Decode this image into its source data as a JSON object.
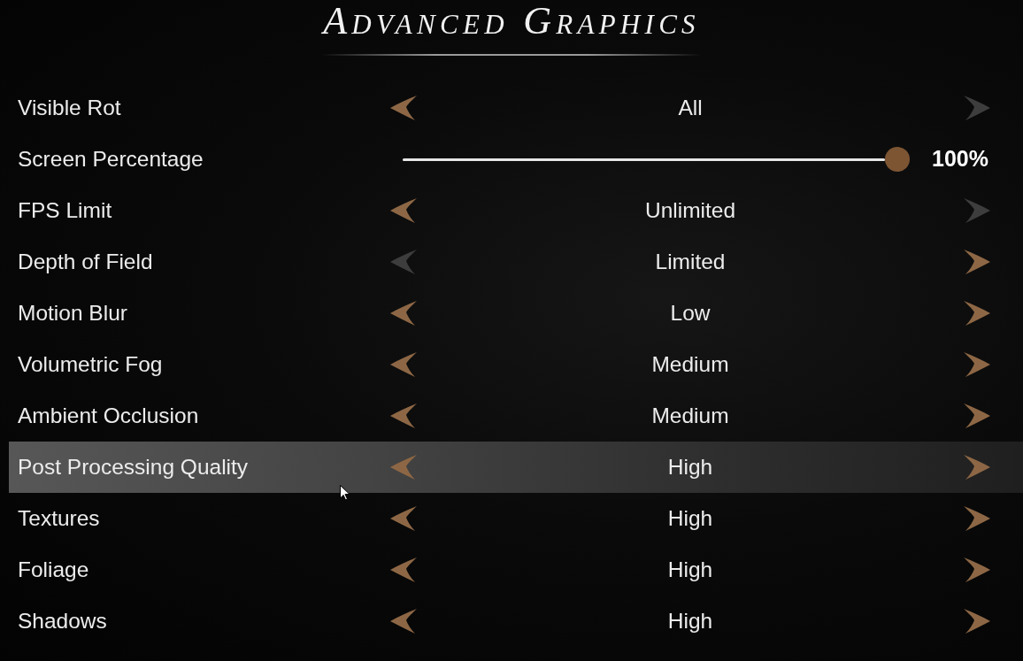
{
  "title": "Advanced Graphics",
  "settings": [
    {
      "kind": "selector",
      "label": "Visible Rot",
      "value": "All",
      "left_arrow_enabled": true,
      "right_arrow_enabled": false,
      "selected": false
    },
    {
      "kind": "slider",
      "label": "Screen Percentage",
      "level": 1,
      "reading": "100%",
      "selected": false
    },
    {
      "kind": "selector",
      "label": "FPS Limit",
      "value": "Unlimited",
      "left_arrow_enabled": true,
      "right_arrow_enabled": false,
      "selected": false
    },
    {
      "kind": "selector",
      "label": "Depth of Field",
      "value": "Limited",
      "left_arrow_enabled": false,
      "right_arrow_enabled": true,
      "selected": false
    },
    {
      "kind": "selector",
      "label": "Motion Blur",
      "value": "Low",
      "left_arrow_enabled": true,
      "right_arrow_enabled": true,
      "selected": false
    },
    {
      "kind": "selector",
      "label": "Volumetric Fog",
      "value": "Medium",
      "left_arrow_enabled": true,
      "right_arrow_enabled": true,
      "selected": false
    },
    {
      "kind": "selector",
      "label": "Ambient Occlusion",
      "value": "Medium",
      "left_arrow_enabled": true,
      "right_arrow_enabled": true,
      "selected": false
    },
    {
      "kind": "selector",
      "label": "Post Processing Quality",
      "value": "High",
      "left_arrow_enabled": true,
      "right_arrow_enabled": true,
      "selected": true
    },
    {
      "kind": "selector",
      "label": "Textures",
      "value": "High",
      "left_arrow_enabled": true,
      "right_arrow_enabled": true,
      "selected": false
    },
    {
      "kind": "selector",
      "label": "Foliage",
      "value": "High",
      "left_arrow_enabled": true,
      "right_arrow_enabled": true,
      "selected": false
    },
    {
      "kind": "selector",
      "label": "Shadows",
      "value": "High",
      "left_arrow_enabled": true,
      "right_arrow_enabled": true,
      "selected": false
    }
  ]
}
